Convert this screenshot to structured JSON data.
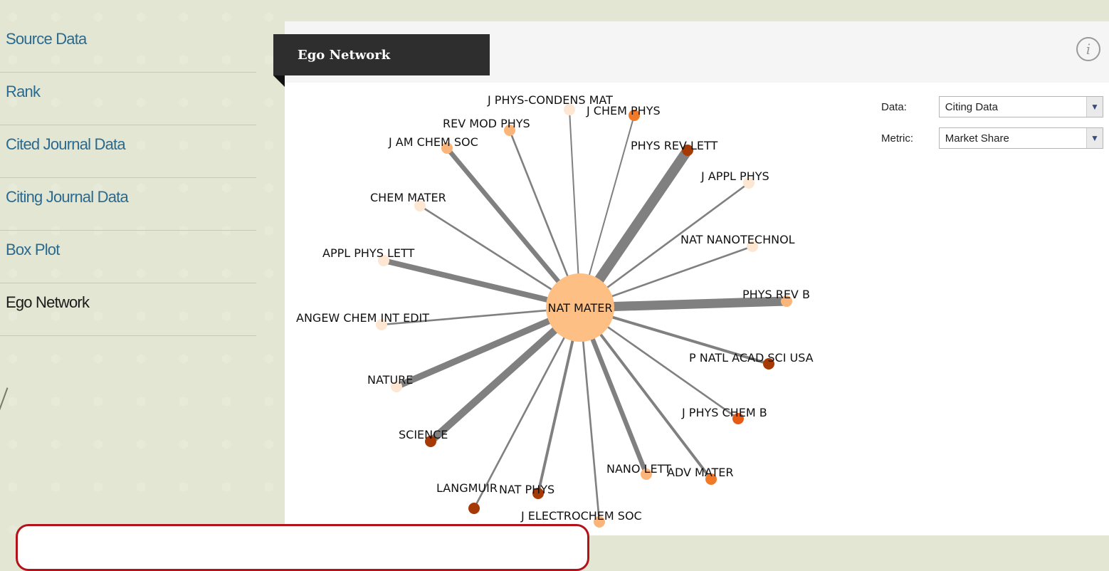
{
  "sidebar": {
    "items": [
      {
        "label": "Source Data",
        "active": false
      },
      {
        "label": "Rank",
        "active": false
      },
      {
        "label": "Cited Journal Data",
        "active": false
      },
      {
        "label": "Citing Journal Data",
        "active": false
      },
      {
        "label": "Box Plot",
        "active": false
      },
      {
        "label": "Ego Network",
        "active": true
      }
    ]
  },
  "panel": {
    "tab_title": "Ego Network",
    "info_icon": "i"
  },
  "controls": {
    "data_label": "Data:",
    "data_value": "Citing Data",
    "metric_label": "Metric:",
    "metric_value": "Market Share"
  },
  "network": {
    "center": {
      "label": "NAT MATER",
      "color": "#fdbf84"
    },
    "nodes": [
      {
        "label": "J PHYS-CONDENS MAT",
        "color": "#fde6d2",
        "weight": 1
      },
      {
        "label": "J CHEM PHYS",
        "color": "#f07a28",
        "weight": 1
      },
      {
        "label": "REV MOD PHYS",
        "color": "#fbb57a",
        "weight": 2
      },
      {
        "label": "J AM CHEM SOC",
        "color": "#fbb57a",
        "weight": 5
      },
      {
        "label": "PHYS REV LETT",
        "color": "#a63a06",
        "weight": 11
      },
      {
        "label": "J APPL PHYS",
        "color": "#fde6d2",
        "weight": 2
      },
      {
        "label": "CHEM MATER",
        "color": "#fde6d2",
        "weight": 2
      },
      {
        "label": "NAT NANOTECHNOL",
        "color": "#fde6d2",
        "weight": 2
      },
      {
        "label": "APPL PHYS LETT",
        "color": "#fde6d2",
        "weight": 6
      },
      {
        "label": "PHYS REV B",
        "color": "#fbb57a",
        "weight": 10
      },
      {
        "label": "ANGEW CHEM INT EDIT",
        "color": "#fde6d2",
        "weight": 2
      },
      {
        "label": "P NATL ACAD SCI USA",
        "color": "#a63a06",
        "weight": 3
      },
      {
        "label": "NATURE",
        "color": "#fde6d2",
        "weight": 7
      },
      {
        "label": "J PHYS CHEM B",
        "color": "#e55a14",
        "weight": 2
      },
      {
        "label": "SCIENCE",
        "color": "#a63a06",
        "weight": 8
      },
      {
        "label": "ADV MATER",
        "color": "#f07a28",
        "weight": 3
      },
      {
        "label": "NANO LETT",
        "color": "#fbb57a",
        "weight": 5
      },
      {
        "label": "LANGMUIR",
        "color": "#a63a06",
        "weight": 2
      },
      {
        "label": "NAT PHYS",
        "color": "#a63a06",
        "weight": 3
      },
      {
        "label": "J ELECTROCHEM SOC",
        "color": "#fbb57a",
        "weight": 2
      }
    ]
  },
  "colors": {
    "edge": "#808080",
    "sidebar_link": "#2a6a90",
    "callout_border": "#b3121a"
  }
}
